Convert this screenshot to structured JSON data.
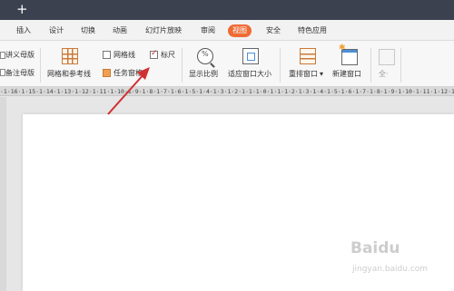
{
  "titlebar": {
    "plus_label": "+"
  },
  "menu": {
    "items": [
      {
        "label": "插入"
      },
      {
        "label": "设计"
      },
      {
        "label": "切换"
      },
      {
        "label": "动画"
      },
      {
        "label": "幻灯片放映"
      },
      {
        "label": "审阅"
      },
      {
        "label": "视图",
        "active": true
      },
      {
        "label": "安全"
      },
      {
        "label": "特色应用"
      }
    ]
  },
  "ribbon": {
    "left_items": [
      "讲义母版",
      "备注母版"
    ],
    "grid_guides_label": "网格和参考线",
    "gridlines_label": "网格线",
    "gridlines_checked": false,
    "task_pane_label": "任务窗格",
    "ruler_label": "标尺",
    "ruler_checked": true,
    "zoom_label": "显示比例",
    "fit_window_label": "适应窗口大小",
    "arrange_label": "重排窗口",
    "arrange_dropdown": "▾",
    "new_window_label": "新建窗口",
    "disabled_label": "全·"
  },
  "ruler": {
    "text": "·1·16·1·15·1·14·1·13·1·12·1·11·1·10·1·9·1·8·1·7·1·6·1·5·1·4·1·3·1·2·1·1·1·0·1·1·1·2·1·3·1·4·1·5·1·6·1·7·1·8·1·9·1·10·1·11·1·12·1·13·1·14·1·15·1·16·1"
  },
  "watermark": {
    "brand": "Baidu",
    "sub": "jingyan.baidu.com"
  },
  "colors": {
    "accent": "#ef6b36",
    "titlebar": "#3c4150",
    "annotation": "#d03030"
  }
}
